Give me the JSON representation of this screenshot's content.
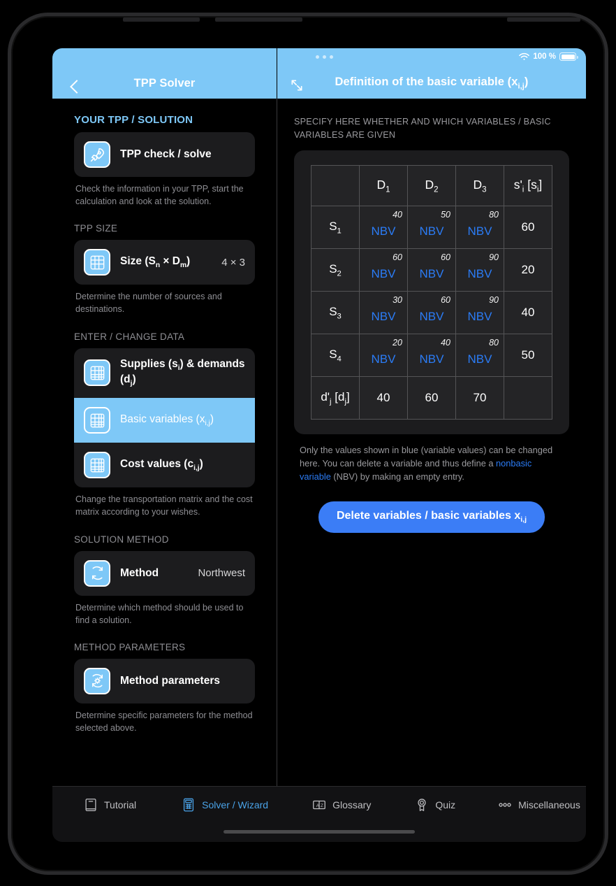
{
  "status": {
    "dots": 3,
    "wifi_icon": "wifi-icon",
    "battery_text": "100 %",
    "battery_icon": "battery-full-icon"
  },
  "navbar": {
    "back_icon": "chevron-left-icon",
    "left_title": "TPP Solver",
    "expand_icon": "expand-arrows-icon",
    "right_title_prefix": "Definition of the basic variable (x",
    "right_title_sub": "i,j",
    "right_title_suffix": ")"
  },
  "sidebar": {
    "sections": [
      {
        "heading": "YOUR TPP / SOLUTION",
        "note": "Check the information in your TPP, start the calculation and look at the solution."
      },
      {
        "heading": "TPP SIZE",
        "note": "Determine the number of sources and destinations."
      },
      {
        "heading": "ENTER / CHANGE DATA",
        "note": "Change the transportation matrix and the cost matrix according to your wishes."
      },
      {
        "heading": "SOLUTION METHOD",
        "note": "Determine which method should be used to find a solution."
      },
      {
        "heading": "METHOD PARAMETERS",
        "note": "Determine specific parameters for the method selected above."
      }
    ],
    "rows": {
      "tpp_check": {
        "label": "TPP check / solve",
        "icon": "rocket-icon"
      },
      "size": {
        "label_pre": "Size (S",
        "label_sub1": "n",
        "label_mid": " × D",
        "label_sub2": "m",
        "label_post": ")",
        "value": "4 × 3",
        "icon": "grid-icon"
      },
      "supplies": {
        "label_pre": "Supplies (s",
        "label_sub1": "i",
        "label_mid": ") & demands (d",
        "label_sub2": "j",
        "label_post": ")",
        "icon": "grid-icon"
      },
      "basic_vars": {
        "label_pre": "Basic variables (x",
        "label_sub1": "i,j",
        "label_post": ")",
        "icon": "grid-icon",
        "selected": true
      },
      "cost_values": {
        "label_pre": "Cost values (c",
        "label_sub1": "i,j",
        "label_post": ")",
        "icon": "grid-icon"
      },
      "method": {
        "label": "Method",
        "value": "Northwest",
        "icon": "refresh-cycle-icon"
      },
      "method_params": {
        "label": "Method parameters",
        "icon": "refresh-gear-icon"
      }
    }
  },
  "main": {
    "intro": "SPECIFY HERE WHETHER AND WHICH VARIABLES / BASIC VARIABLES ARE GIVEN",
    "note_part1": "Only the values shown in blue (variable values) can be changed here. You can delete a variable and thus define a ",
    "note_link": "nonbasic variable",
    "note_part2": " (NBV) by making an empty entry.",
    "delete_button_pre": "Delete variables / basic variables x",
    "delete_button_sub": "i,j",
    "colors": {
      "accent": "#7ec8f7",
      "blue_value": "#2b7cf6",
      "button": "#3b7df6"
    }
  },
  "chart_data": {
    "type": "table",
    "title": "Definition of the basic variable (xi,j)",
    "col_headers": [
      "",
      "D1",
      "D2",
      "D3",
      "s'i [si]"
    ],
    "row_headers": [
      "S1",
      "S2",
      "S3",
      "S4",
      "d'j [dj]"
    ],
    "costs": [
      [
        40,
        50,
        80
      ],
      [
        60,
        60,
        90
      ],
      [
        30,
        60,
        90
      ],
      [
        20,
        40,
        80
      ]
    ],
    "variables": [
      [
        "NBV",
        "NBV",
        "NBV"
      ],
      [
        "NBV",
        "NBV",
        "NBV"
      ],
      [
        "NBV",
        "NBV",
        "NBV"
      ],
      [
        "NBV",
        "NBV",
        "NBV"
      ]
    ],
    "supplies": [
      60,
      20,
      40,
      50
    ],
    "demands": [
      40,
      60,
      70
    ],
    "supply_header": "s'i [si]",
    "demand_header": "d'j [dj]"
  },
  "tabbar": {
    "items": [
      {
        "label": "Tutorial",
        "icon": "book-icon",
        "active": false
      },
      {
        "label": "Solver / Wizard",
        "icon": "calculator-icon",
        "active": true
      },
      {
        "label": "Glossary",
        "icon": "az-box-icon",
        "active": false
      },
      {
        "label": "Quiz",
        "icon": "award-ribbon-icon",
        "active": false
      },
      {
        "label": "Miscellaneous",
        "icon": "three-circles-icon",
        "active": false
      }
    ]
  }
}
